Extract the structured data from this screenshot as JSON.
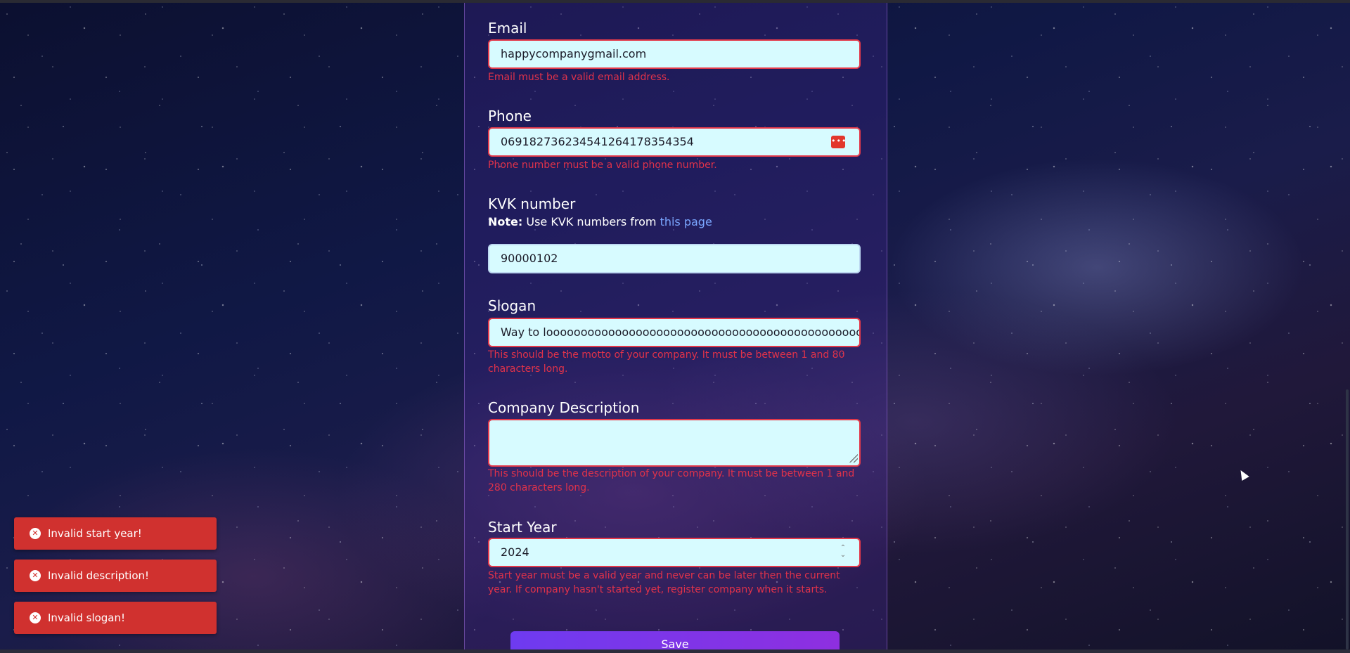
{
  "form": {
    "email": {
      "label": "Email",
      "value": "happycompanygmail.com",
      "error": "Email must be a valid email address."
    },
    "phone": {
      "label": "Phone",
      "value": "069182736234541264178354354",
      "error": "Phone number must be a valid phone number.",
      "icon_text": "•••"
    },
    "kvk": {
      "label": "KVK number",
      "note_bold": "Note:",
      "note_text": "Use KVK numbers from",
      "note_link": "this page",
      "value": "90000102"
    },
    "slogan": {
      "label": "Slogan",
      "value": "Way to looooooooooooooooooooooooooooooooooooooooooooooooooooooooo",
      "error": "This should be the motto of your company. It must be between 1 and 80 characters long."
    },
    "description": {
      "label": "Company Description",
      "value": "",
      "error": "This should be the description of your company. It must be between 1 and 280 characters long."
    },
    "start_year": {
      "label": "Start Year",
      "value": "2024",
      "error": "Start year must be a valid year and never can be later then the current year. If company hasn't started yet, register company when it starts."
    },
    "save_label": "Save"
  },
  "toasts": [
    {
      "text": "Invalid start year!"
    },
    {
      "text": "Invalid description!"
    },
    {
      "text": "Invalid slogan!"
    }
  ],
  "colors": {
    "error": "#e0324a",
    "field_bg": "#d7fbff",
    "toast_bg": "#d0312f",
    "button": "#7a35e8",
    "link": "#7aa6ff"
  }
}
